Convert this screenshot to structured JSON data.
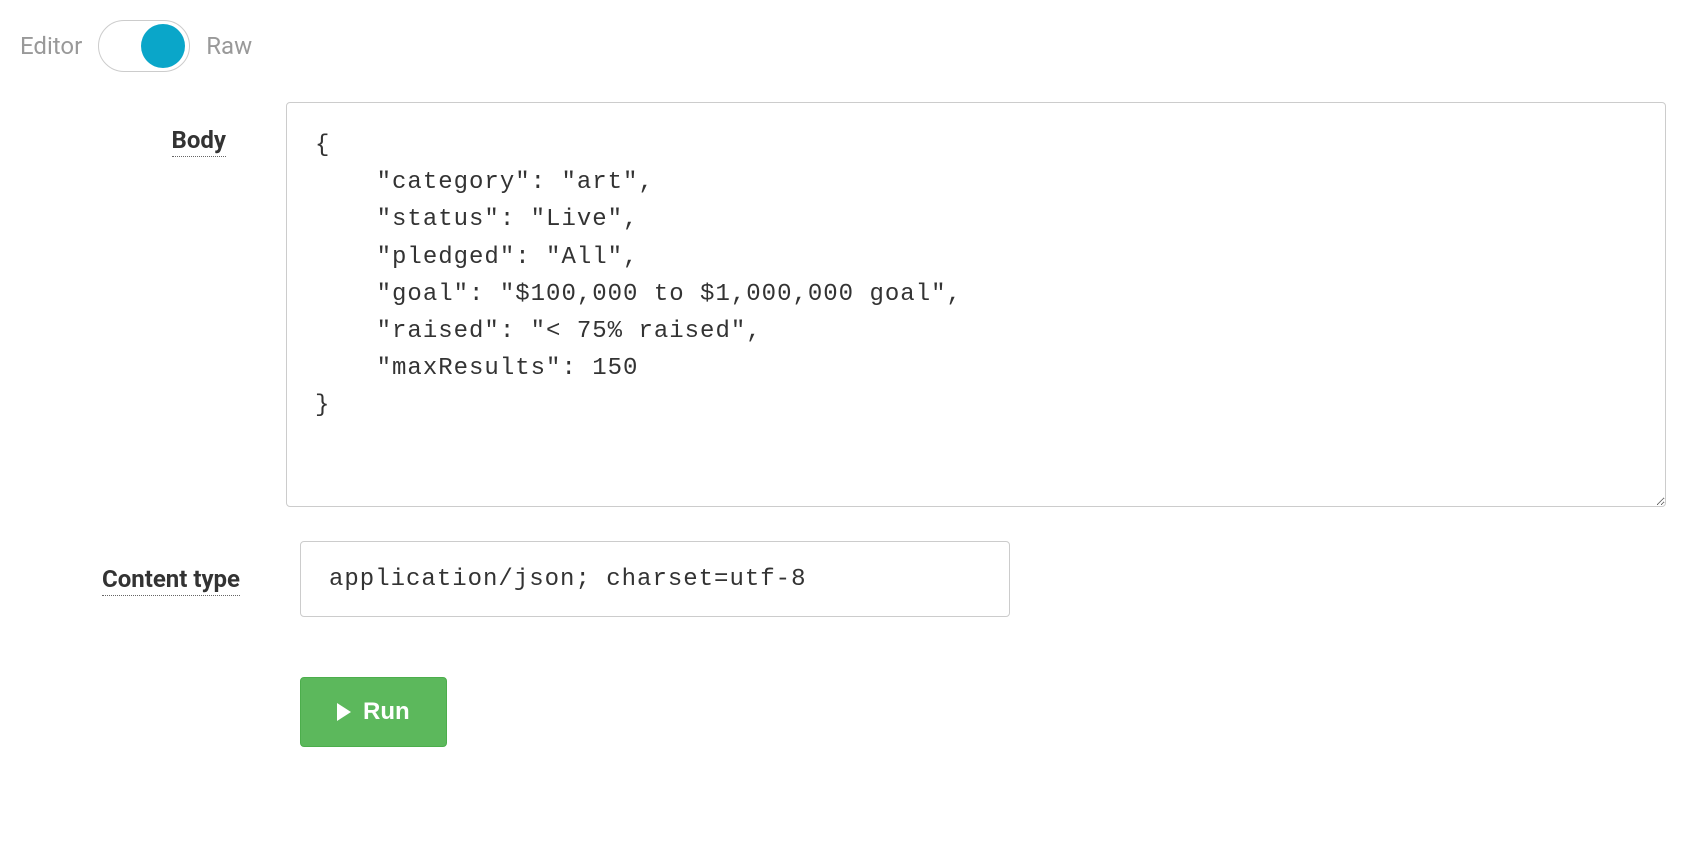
{
  "toggle": {
    "left_label": "Editor",
    "right_label": "Raw",
    "state": "raw"
  },
  "body": {
    "label": "Body",
    "value": "{\n    \"category\": \"art\",\n    \"status\": \"Live\",\n    \"pledged\": \"All\",\n    \"goal\": \"$100,000 to $1,000,000 goal\",\n    \"raised\": \"< 75% raised\",\n    \"maxResults\": 150\n}"
  },
  "content_type": {
    "label": "Content type",
    "value": "application/json; charset=utf-8"
  },
  "run": {
    "label": "Run"
  }
}
